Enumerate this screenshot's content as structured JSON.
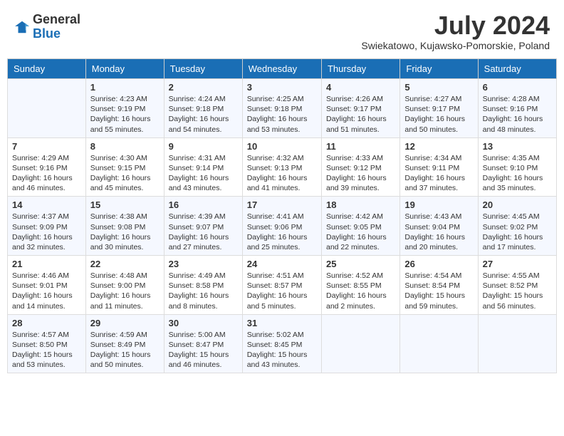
{
  "header": {
    "logo_general": "General",
    "logo_blue": "Blue",
    "month_title": "July 2024",
    "subtitle": "Swiekatowo, Kujawsko-Pomorskie, Poland"
  },
  "days_of_week": [
    "Sunday",
    "Monday",
    "Tuesday",
    "Wednesday",
    "Thursday",
    "Friday",
    "Saturday"
  ],
  "weeks": [
    [
      {
        "day": "",
        "sunrise": "",
        "sunset": "",
        "daylight": ""
      },
      {
        "day": "1",
        "sunrise": "Sunrise: 4:23 AM",
        "sunset": "Sunset: 9:19 PM",
        "daylight": "Daylight: 16 hours and 55 minutes."
      },
      {
        "day": "2",
        "sunrise": "Sunrise: 4:24 AM",
        "sunset": "Sunset: 9:18 PM",
        "daylight": "Daylight: 16 hours and 54 minutes."
      },
      {
        "day": "3",
        "sunrise": "Sunrise: 4:25 AM",
        "sunset": "Sunset: 9:18 PM",
        "daylight": "Daylight: 16 hours and 53 minutes."
      },
      {
        "day": "4",
        "sunrise": "Sunrise: 4:26 AM",
        "sunset": "Sunset: 9:17 PM",
        "daylight": "Daylight: 16 hours and 51 minutes."
      },
      {
        "day": "5",
        "sunrise": "Sunrise: 4:27 AM",
        "sunset": "Sunset: 9:17 PM",
        "daylight": "Daylight: 16 hours and 50 minutes."
      },
      {
        "day": "6",
        "sunrise": "Sunrise: 4:28 AM",
        "sunset": "Sunset: 9:16 PM",
        "daylight": "Daylight: 16 hours and 48 minutes."
      }
    ],
    [
      {
        "day": "7",
        "sunrise": "Sunrise: 4:29 AM",
        "sunset": "Sunset: 9:16 PM",
        "daylight": "Daylight: 16 hours and 46 minutes."
      },
      {
        "day": "8",
        "sunrise": "Sunrise: 4:30 AM",
        "sunset": "Sunset: 9:15 PM",
        "daylight": "Daylight: 16 hours and 45 minutes."
      },
      {
        "day": "9",
        "sunrise": "Sunrise: 4:31 AM",
        "sunset": "Sunset: 9:14 PM",
        "daylight": "Daylight: 16 hours and 43 minutes."
      },
      {
        "day": "10",
        "sunrise": "Sunrise: 4:32 AM",
        "sunset": "Sunset: 9:13 PM",
        "daylight": "Daylight: 16 hours and 41 minutes."
      },
      {
        "day": "11",
        "sunrise": "Sunrise: 4:33 AM",
        "sunset": "Sunset: 9:12 PM",
        "daylight": "Daylight: 16 hours and 39 minutes."
      },
      {
        "day": "12",
        "sunrise": "Sunrise: 4:34 AM",
        "sunset": "Sunset: 9:11 PM",
        "daylight": "Daylight: 16 hours and 37 minutes."
      },
      {
        "day": "13",
        "sunrise": "Sunrise: 4:35 AM",
        "sunset": "Sunset: 9:10 PM",
        "daylight": "Daylight: 16 hours and 35 minutes."
      }
    ],
    [
      {
        "day": "14",
        "sunrise": "Sunrise: 4:37 AM",
        "sunset": "Sunset: 9:09 PM",
        "daylight": "Daylight: 16 hours and 32 minutes."
      },
      {
        "day": "15",
        "sunrise": "Sunrise: 4:38 AM",
        "sunset": "Sunset: 9:08 PM",
        "daylight": "Daylight: 16 hours and 30 minutes."
      },
      {
        "day": "16",
        "sunrise": "Sunrise: 4:39 AM",
        "sunset": "Sunset: 9:07 PM",
        "daylight": "Daylight: 16 hours and 27 minutes."
      },
      {
        "day": "17",
        "sunrise": "Sunrise: 4:41 AM",
        "sunset": "Sunset: 9:06 PM",
        "daylight": "Daylight: 16 hours and 25 minutes."
      },
      {
        "day": "18",
        "sunrise": "Sunrise: 4:42 AM",
        "sunset": "Sunset: 9:05 PM",
        "daylight": "Daylight: 16 hours and 22 minutes."
      },
      {
        "day": "19",
        "sunrise": "Sunrise: 4:43 AM",
        "sunset": "Sunset: 9:04 PM",
        "daylight": "Daylight: 16 hours and 20 minutes."
      },
      {
        "day": "20",
        "sunrise": "Sunrise: 4:45 AM",
        "sunset": "Sunset: 9:02 PM",
        "daylight": "Daylight: 16 hours and 17 minutes."
      }
    ],
    [
      {
        "day": "21",
        "sunrise": "Sunrise: 4:46 AM",
        "sunset": "Sunset: 9:01 PM",
        "daylight": "Daylight: 16 hours and 14 minutes."
      },
      {
        "day": "22",
        "sunrise": "Sunrise: 4:48 AM",
        "sunset": "Sunset: 9:00 PM",
        "daylight": "Daylight: 16 hours and 11 minutes."
      },
      {
        "day": "23",
        "sunrise": "Sunrise: 4:49 AM",
        "sunset": "Sunset: 8:58 PM",
        "daylight": "Daylight: 16 hours and 8 minutes."
      },
      {
        "day": "24",
        "sunrise": "Sunrise: 4:51 AM",
        "sunset": "Sunset: 8:57 PM",
        "daylight": "Daylight: 16 hours and 5 minutes."
      },
      {
        "day": "25",
        "sunrise": "Sunrise: 4:52 AM",
        "sunset": "Sunset: 8:55 PM",
        "daylight": "Daylight: 16 hours and 2 minutes."
      },
      {
        "day": "26",
        "sunrise": "Sunrise: 4:54 AM",
        "sunset": "Sunset: 8:54 PM",
        "daylight": "Daylight: 15 hours and 59 minutes."
      },
      {
        "day": "27",
        "sunrise": "Sunrise: 4:55 AM",
        "sunset": "Sunset: 8:52 PM",
        "daylight": "Daylight: 15 hours and 56 minutes."
      }
    ],
    [
      {
        "day": "28",
        "sunrise": "Sunrise: 4:57 AM",
        "sunset": "Sunset: 8:50 PM",
        "daylight": "Daylight: 15 hours and 53 minutes."
      },
      {
        "day": "29",
        "sunrise": "Sunrise: 4:59 AM",
        "sunset": "Sunset: 8:49 PM",
        "daylight": "Daylight: 15 hours and 50 minutes."
      },
      {
        "day": "30",
        "sunrise": "Sunrise: 5:00 AM",
        "sunset": "Sunset: 8:47 PM",
        "daylight": "Daylight: 15 hours and 46 minutes."
      },
      {
        "day": "31",
        "sunrise": "Sunrise: 5:02 AM",
        "sunset": "Sunset: 8:45 PM",
        "daylight": "Daylight: 15 hours and 43 minutes."
      },
      {
        "day": "",
        "sunrise": "",
        "sunset": "",
        "daylight": ""
      },
      {
        "day": "",
        "sunrise": "",
        "sunset": "",
        "daylight": ""
      },
      {
        "day": "",
        "sunrise": "",
        "sunset": "",
        "daylight": ""
      }
    ]
  ]
}
